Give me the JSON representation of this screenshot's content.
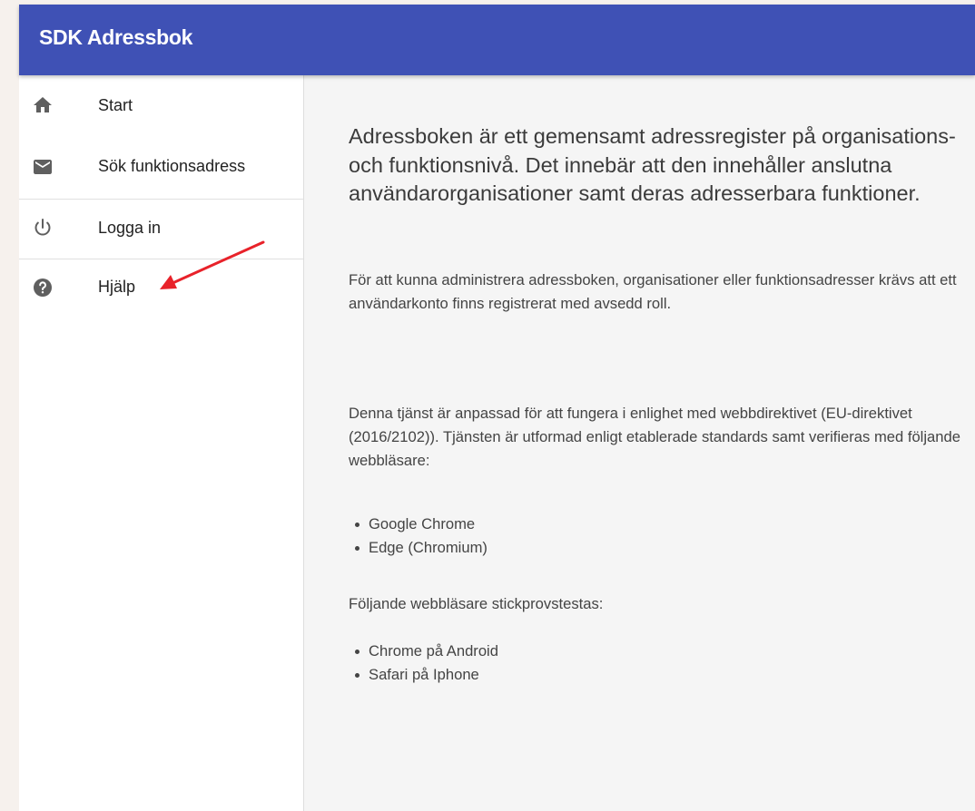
{
  "app_bar": {
    "title": "SDK Adressbok"
  },
  "sidebar": {
    "items": [
      {
        "label": "Start",
        "icon": "home-icon"
      },
      {
        "label": "Sök funktionsadress",
        "icon": "mail-icon"
      },
      {
        "label": "Logga in",
        "icon": "power-icon"
      },
      {
        "label": "Hjälp",
        "icon": "help-icon"
      }
    ]
  },
  "main": {
    "lead": "Adressboken är ett gemensamt adressregister på organisations- och funktionsnivå. Det innebär att den innehåller anslutna användarorganisationer samt deras adresserbara funktioner.",
    "admin_note": "För att kunna administrera adressboken, organisationer eller funktionsadresser krävs att ett användarkonto finns registrerat med avsedd roll.",
    "compliance_note": "Denna tjänst är anpassad för att fungera i enlighet med webbdirektivet (EU-direktivet (2016/2102)). Tjänsten är utformad enligt etablerade standards samt verifieras med följande webbläsare:",
    "verified_browsers": [
      "Google Chrome",
      "Edge (Chromium)"
    ],
    "spot_check_heading": "Följande webbläsare stickprovstestas:",
    "spot_check_browsers": [
      "Chrome på Android",
      "Safari på Iphone"
    ]
  },
  "colors": {
    "app_bar": "#3f51b5",
    "annotation_arrow": "#e8222a",
    "icon": "#5f5f5f"
  }
}
